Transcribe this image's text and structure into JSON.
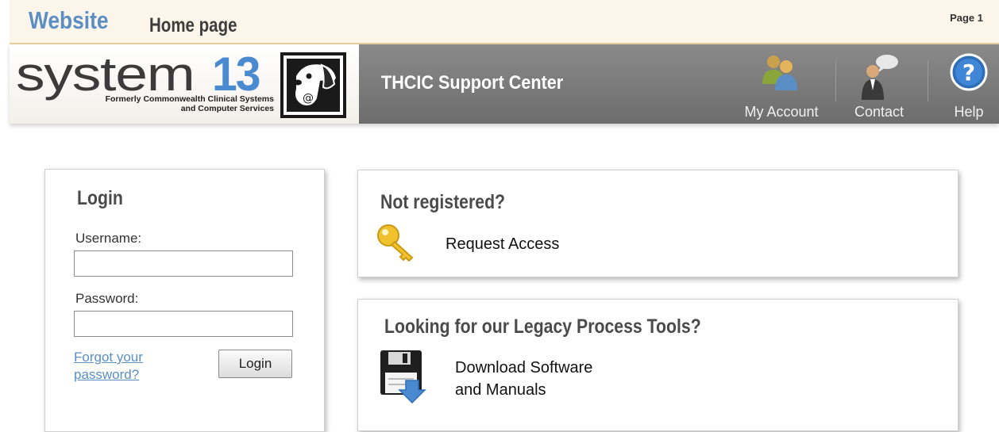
{
  "topbar": {
    "website": "Website",
    "home_page": "Home page",
    "page_label": "Page 1"
  },
  "logo": {
    "word": "system",
    "number": "13",
    "tagline_line1": "Formerly Commonwealth Clinical Systems",
    "tagline_line2": "and Computer Services"
  },
  "header": {
    "site_title": "THCIC Support Center",
    "nav": [
      {
        "label": "My Account",
        "icon": "people-icon"
      },
      {
        "label": "Contact",
        "icon": "contact-person-icon"
      },
      {
        "label": "Help",
        "icon": "help-icon"
      }
    ]
  },
  "login": {
    "title": "Login",
    "username_label": "Username:",
    "username_value": "",
    "password_label": "Password:",
    "password_value": "",
    "forgot_line1": "Forgot your",
    "forgot_line2": "password?",
    "button": "Login"
  },
  "register": {
    "title": "Not registered?",
    "link": "Request Access",
    "icon": "key-icon"
  },
  "legacy": {
    "title": "Looking for our Legacy Process Tools?",
    "link_line1": "Download Software",
    "link_line2": "and Manuals",
    "icon": "floppy-download-icon"
  },
  "colors": {
    "accent_blue": "#5b8ec4",
    "logo_blue": "#4a8ad0",
    "header_gray": "#7a7a7a",
    "topbar_bg": "#fcf5ea"
  }
}
